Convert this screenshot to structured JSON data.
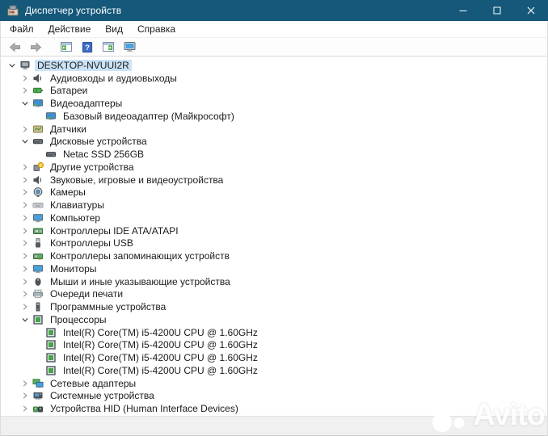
{
  "window": {
    "title": "Диспетчер устройств",
    "controls": [
      {
        "name": "minimize"
      },
      {
        "name": "maximize"
      },
      {
        "name": "close"
      }
    ]
  },
  "menu": {
    "items": [
      {
        "label": "Файл"
      },
      {
        "label": "Действие"
      },
      {
        "label": "Вид"
      },
      {
        "label": "Справка"
      }
    ]
  },
  "toolbar": {
    "buttons": [
      {
        "name": "back",
        "icon": "arrow-left"
      },
      {
        "name": "forward",
        "icon": "arrow-right"
      },
      {
        "name": "show-console-tree",
        "icon": "console-tree"
      },
      {
        "name": "help",
        "icon": "help"
      },
      {
        "name": "properties",
        "icon": "properties"
      },
      {
        "name": "scan-hardware-changes",
        "icon": "scan-monitor"
      }
    ]
  },
  "tree": {
    "rows": [
      {
        "level": 0,
        "state": "expanded",
        "icon": "computer",
        "label": "DESKTOP-NVUUI2R",
        "selected": true
      },
      {
        "level": 1,
        "state": "collapsed",
        "icon": "audio-device",
        "label": "Аудиовходы и аудиовыходы"
      },
      {
        "level": 1,
        "state": "collapsed",
        "icon": "battery",
        "label": "Батареи"
      },
      {
        "level": 1,
        "state": "expanded",
        "icon": "display-adapter",
        "label": "Видеоадаптеры"
      },
      {
        "level": 2,
        "state": "leaf",
        "icon": "display-adapter",
        "label": "Базовый видеоадаптер (Майкрософт)"
      },
      {
        "level": 1,
        "state": "collapsed",
        "icon": "sensor",
        "label": "Датчики"
      },
      {
        "level": 1,
        "state": "expanded",
        "icon": "disk-drive",
        "label": "Дисковые устройства"
      },
      {
        "level": 2,
        "state": "leaf",
        "icon": "disk-drive",
        "label": "Netac SSD 256GB"
      },
      {
        "level": 1,
        "state": "collapsed",
        "icon": "unknown-device",
        "label": "Другие устройства"
      },
      {
        "level": 1,
        "state": "collapsed",
        "icon": "audio-device",
        "label": "Звуковые, игровые и видеоустройства"
      },
      {
        "level": 1,
        "state": "collapsed",
        "icon": "camera",
        "label": "Камеры"
      },
      {
        "level": 1,
        "state": "collapsed",
        "icon": "keyboard",
        "label": "Клавиатуры"
      },
      {
        "level": 1,
        "state": "collapsed",
        "icon": "monitor",
        "label": "Компьютер"
      },
      {
        "level": 1,
        "state": "collapsed",
        "icon": "ide-controller",
        "label": "Контроллеры IDE ATA/ATAPI"
      },
      {
        "level": 1,
        "state": "collapsed",
        "icon": "usb-controller",
        "label": "Контроллеры USB"
      },
      {
        "level": 1,
        "state": "collapsed",
        "icon": "storage-controller",
        "label": "Контроллеры запоминающих устройств"
      },
      {
        "level": 1,
        "state": "collapsed",
        "icon": "monitor",
        "label": "Мониторы"
      },
      {
        "level": 1,
        "state": "collapsed",
        "icon": "mouse",
        "label": "Мыши и иные указывающие устройства"
      },
      {
        "level": 1,
        "state": "collapsed",
        "icon": "print-queue",
        "label": "Очереди печати"
      },
      {
        "level": 1,
        "state": "collapsed",
        "icon": "software-device",
        "label": "Программные устройства"
      },
      {
        "level": 1,
        "state": "expanded",
        "icon": "processor",
        "label": "Процессоры"
      },
      {
        "level": 2,
        "state": "leaf",
        "icon": "processor",
        "label": "Intel(R) Core(TM) i5-4200U CPU @ 1.60GHz"
      },
      {
        "level": 2,
        "state": "leaf",
        "icon": "processor",
        "label": "Intel(R) Core(TM) i5-4200U CPU @ 1.60GHz"
      },
      {
        "level": 2,
        "state": "leaf",
        "icon": "processor",
        "label": "Intel(R) Core(TM) i5-4200U CPU @ 1.60GHz"
      },
      {
        "level": 2,
        "state": "leaf",
        "icon": "processor",
        "label": "Intel(R) Core(TM) i5-4200U CPU @ 1.60GHz"
      },
      {
        "level": 1,
        "state": "collapsed",
        "icon": "network-adapter",
        "label": "Сетевые адаптеры"
      },
      {
        "level": 1,
        "state": "collapsed",
        "icon": "system-device",
        "label": "Системные устройства"
      },
      {
        "level": 1,
        "state": "collapsed",
        "icon": "hid-device",
        "label": "Устройства HID (Human Interface Devices)"
      }
    ]
  },
  "watermark": {
    "text": "Avito"
  },
  "colors": {
    "titlebar_bg": "#15587a",
    "titlebar_text": "#ffffff",
    "selection_bg": "#cbe3f7",
    "chrome_bg": "#f0f0f0",
    "accent_green": "#52ae52",
    "help_blue": "#3d6cc4"
  }
}
